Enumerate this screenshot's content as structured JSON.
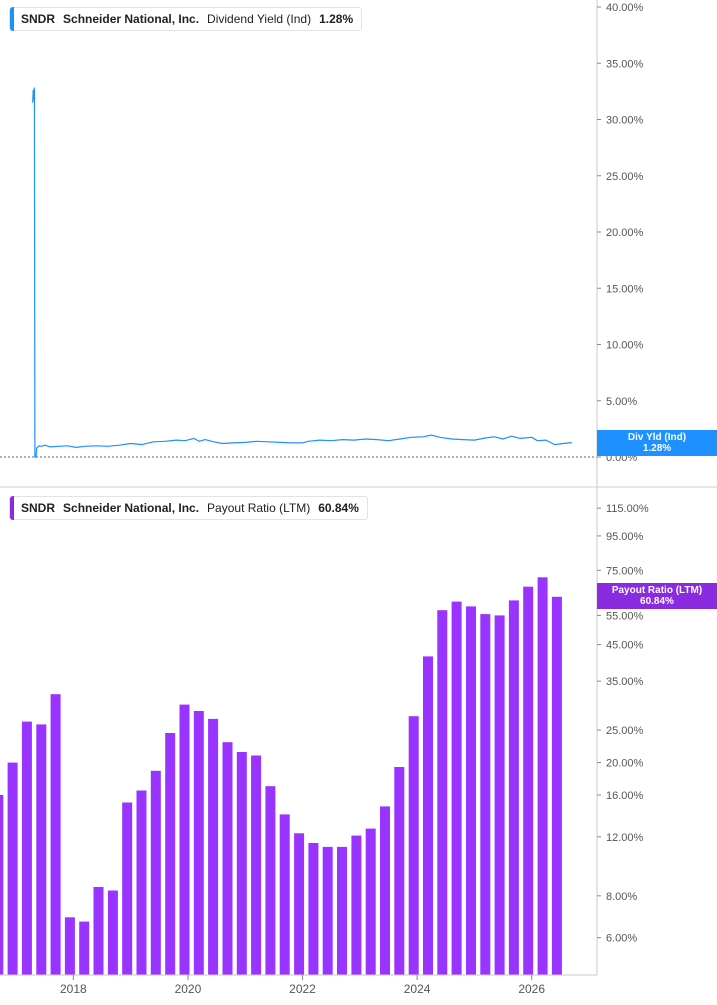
{
  "colors": {
    "dividend_line": "#1e90ff",
    "payout_bar": "#9933ff",
    "payout_tag": "#8a2be2",
    "axis": "#c9c9c9",
    "text": "#555555"
  },
  "legend_top": {
    "ticker": "SNDR",
    "name": "Schneider National, Inc.",
    "metric": "Dividend Yield (Ind)",
    "value": "1.28%"
  },
  "legend_bottom": {
    "ticker": "SNDR",
    "name": "Schneider National, Inc.",
    "metric": "Payout Ratio (LTM)",
    "value": "60.84%"
  },
  "tag_top": {
    "line1": "Div Yld (Ind)",
    "line2": "1.28%"
  },
  "tag_bottom": {
    "line1": "Payout Ratio (LTM)",
    "line2": "60.84%"
  },
  "x_axis": {
    "ticks": [
      "2018",
      "2020",
      "2022",
      "2024",
      "2026"
    ],
    "tick_values": [
      2018,
      2020,
      2022,
      2024,
      2026
    ],
    "range": [
      2016.72,
      2027.14
    ]
  },
  "chart_data": [
    {
      "type": "line",
      "title": "Dividend Yield (Ind)",
      "ylim": [
        0,
        40
      ],
      "y_ticks": [
        "0.00%",
        "5.00%",
        "10.00%",
        "15.00%",
        "20.00%",
        "25.00%",
        "30.00%",
        "35.00%",
        "40.00%"
      ],
      "y_tick_values": [
        0,
        5,
        10,
        15,
        20,
        25,
        30,
        35,
        40
      ],
      "series": [
        {
          "name": "Dividend Yield (Ind)",
          "x": [
            2017.29,
            2017.3,
            2017.31,
            2017.32,
            2017.33,
            2017.34,
            2017.35,
            2017.36,
            2017.4,
            2017.45,
            2017.5,
            2017.6,
            2017.75,
            2017.9,
            2018.05,
            2018.2,
            2018.4,
            2018.6,
            2018.8,
            2019.0,
            2019.2,
            2019.4,
            2019.6,
            2019.8,
            2019.95,
            2020.1,
            2020.2,
            2020.3,
            2020.45,
            2020.6,
            2020.8,
            2021.0,
            2021.2,
            2021.4,
            2021.6,
            2021.8,
            2022.0,
            2022.1,
            2022.3,
            2022.5,
            2022.7,
            2022.9,
            2023.1,
            2023.3,
            2023.5,
            2023.7,
            2023.9,
            2024.1,
            2024.25,
            2024.4,
            2024.6,
            2024.8,
            2025.0,
            2025.2,
            2025.35,
            2025.5,
            2025.65,
            2025.8,
            2026.0,
            2026.1,
            2026.25,
            2026.4,
            2026.55,
            2026.7
          ],
          "values": [
            31.5,
            32.6,
            31.8,
            32.8,
            0.0,
            0.0,
            0.0,
            0.8,
            1.0,
            0.95,
            1.05,
            0.9,
            0.95,
            1.0,
            0.85,
            0.95,
            1.0,
            0.95,
            1.05,
            1.2,
            1.1,
            1.35,
            1.4,
            1.5,
            1.45,
            1.65,
            1.4,
            1.55,
            1.35,
            1.2,
            1.25,
            1.3,
            1.4,
            1.35,
            1.3,
            1.25,
            1.25,
            1.4,
            1.5,
            1.45,
            1.55,
            1.5,
            1.6,
            1.55,
            1.45,
            1.6,
            1.75,
            1.8,
            1.95,
            1.75,
            1.6,
            1.55,
            1.5,
            1.7,
            1.8,
            1.6,
            1.85,
            1.65,
            1.75,
            1.45,
            1.5,
            1.1,
            1.2,
            1.28
          ]
        }
      ]
    },
    {
      "type": "bar",
      "title": "Payout Ratio (LTM)",
      "y_scale": "log",
      "ylim": [
        5.4,
        125
      ],
      "y_ticks": [
        "6.00%",
        "8.00%",
        "12.00%",
        "16.00%",
        "20.00%",
        "25.00%",
        "35.00%",
        "45.00%",
        "55.00%",
        "75.00%",
        "95.00%",
        "115.00%"
      ],
      "y_tick_values": [
        6,
        8,
        12,
        16,
        20,
        25,
        35,
        45,
        55,
        75,
        95,
        115
      ],
      "series": [
        {
          "name": "Payout Ratio (LTM)",
          "x": [
            2016.69,
            2016.94,
            2017.19,
            2017.44,
            2017.69,
            2017.94,
            2018.19,
            2018.44,
            2018.69,
            2018.94,
            2019.19,
            2019.44,
            2019.69,
            2019.94,
            2020.19,
            2020.44,
            2020.69,
            2020.94,
            2021.19,
            2021.44,
            2021.69,
            2021.94,
            2022.19,
            2022.44,
            2022.69,
            2022.94,
            2023.19,
            2023.44,
            2023.69,
            2023.94,
            2024.19,
            2024.44,
            2024.69,
            2024.94,
            2025.19,
            2025.44,
            2025.69,
            2025.94,
            2026.19,
            2026.44
          ],
          "values": [
            16,
            20,
            26.5,
            26,
            32,
            6.9,
            6.7,
            8.5,
            8.3,
            15.2,
            16.5,
            18.9,
            24.5,
            29.8,
            28.5,
            27,
            23,
            21.5,
            21,
            17,
            14,
            12.3,
            11.5,
            11.2,
            11.2,
            12.1,
            12.7,
            14.8,
            19.4,
            27.5,
            41.5,
            57,
            60.5,
            58.5,
            55.5,
            55,
            61,
            67,
            71.5,
            62.5
          ]
        }
      ]
    }
  ]
}
